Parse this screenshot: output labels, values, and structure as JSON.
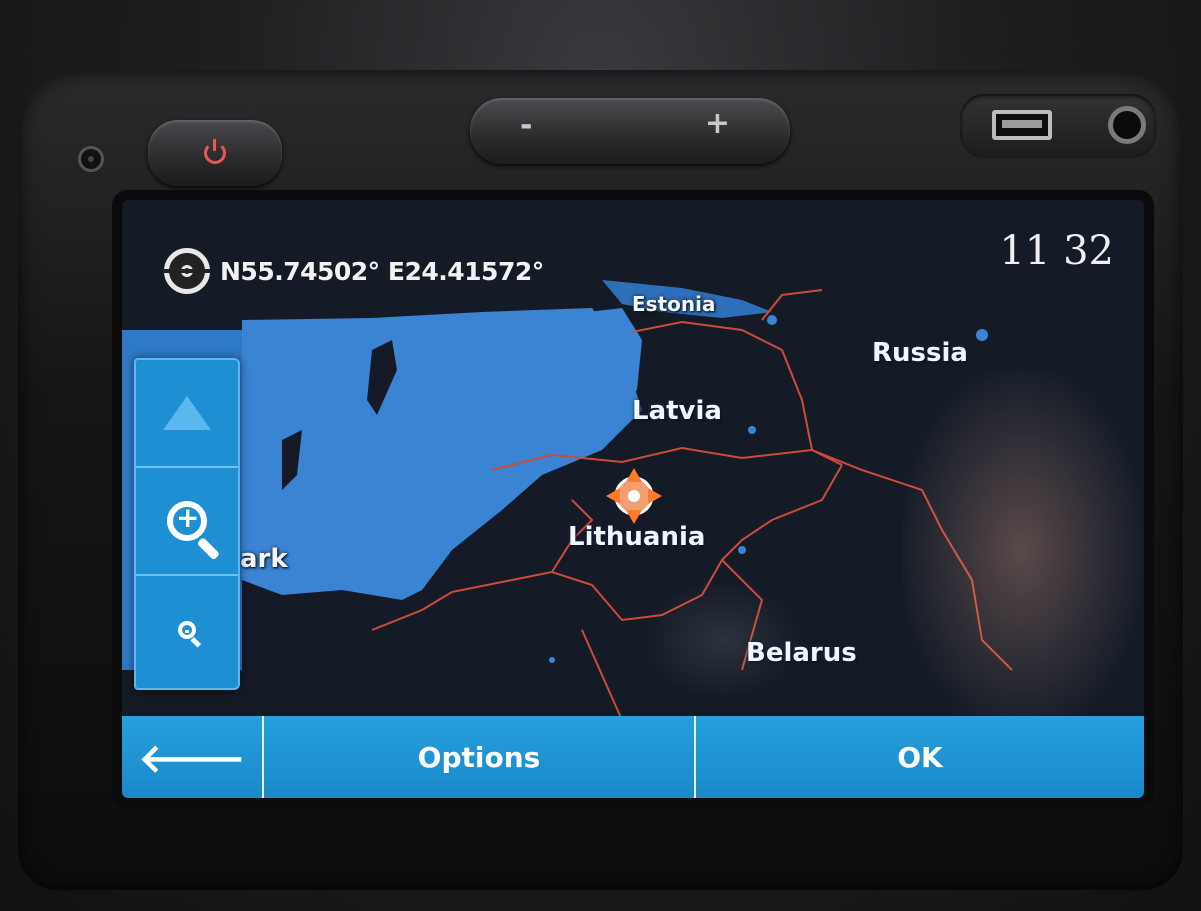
{
  "hardware": {
    "power_icon": "power-icon",
    "volume_minus_label": "-",
    "volume_plus_label": "+",
    "usb_icon": "usb-port-icon",
    "aux_icon": "aux-jack-icon"
  },
  "status": {
    "coordinates": "N55.74502° E24.41572°",
    "clock": "11 32",
    "gps_icon": "gps-crosshair-icon"
  },
  "map": {
    "labels": {
      "estonia_partial": "Estonia",
      "russia": "Russia",
      "latvia": "Latvia",
      "lithuania": "Lithuania",
      "denmark_partial": "ark",
      "belarus": "Belarus"
    },
    "colors": {
      "sea": "#3a86d6",
      "land": "#141b26",
      "border": "#d0503c"
    },
    "cursor_icon": "position-cursor-icon"
  },
  "side_panel": {
    "north_icon": "north-arrow-icon",
    "zoom_in_icon": "zoom-in-icon",
    "zoom_out_icon": "zoom-out-icon"
  },
  "bottom_bar": {
    "back_icon": "back-arrow-icon",
    "back_glyph": "🡐",
    "options_label": "Options",
    "ok_label": "OK"
  },
  "accent": "#1f8fd4"
}
